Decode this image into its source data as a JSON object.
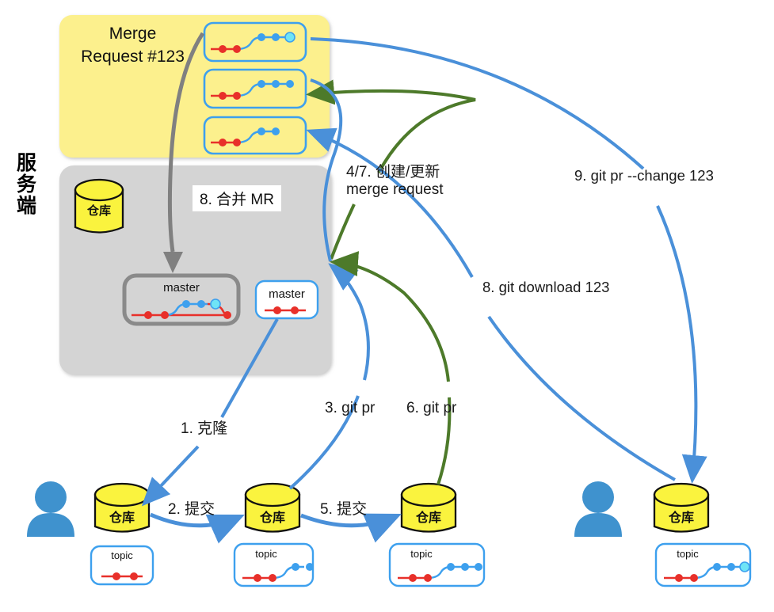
{
  "diagram": {
    "title_vertical": "服务端",
    "server_panel": {
      "mr_card_title": "Merge\nRequest #123",
      "merge_label": "8. 合并 MR",
      "repo_label": "仓库",
      "master_label": "master",
      "mr_items": [
        {
          "id": "mr-graph-1",
          "red_commits": 2,
          "blue_commits": 3,
          "head_highlight": true
        },
        {
          "id": "mr-graph-2",
          "red_commits": 2,
          "blue_commits": 3,
          "head_highlight": false
        },
        {
          "id": "mr-graph-3",
          "red_commits": 2,
          "blue_commits": 2,
          "head_highlight": false
        }
      ],
      "merged_master": {
        "label": "master",
        "red_commits": 3,
        "blue_commits": 3,
        "merged": true
      },
      "clone_master": {
        "label": "master",
        "red_commits": 2,
        "blue_commits": 0
      }
    },
    "clients": [
      {
        "id": "client-left",
        "person": "user-avatar",
        "repo_label": "仓库",
        "topic": {
          "label": "topic",
          "red_commits": 2,
          "blue_commits": 0,
          "head_highlight": false
        }
      },
      {
        "id": "client-mid",
        "repo_label": "仓库",
        "topic": {
          "label": "topic",
          "red_commits": 2,
          "blue_commits": 2,
          "head_highlight": false
        }
      },
      {
        "id": "client-mid2",
        "repo_label": "仓库",
        "topic": {
          "label": "topic",
          "red_commits": 2,
          "blue_commits": 3,
          "head_highlight": false
        }
      },
      {
        "id": "client-right",
        "person": "user-avatar",
        "repo_label": "仓库",
        "topic": {
          "label": "topic",
          "red_commits": 2,
          "blue_commits": 3,
          "head_highlight": true
        }
      }
    ],
    "edges": [
      {
        "id": "edge-clone",
        "label": "1. 克隆",
        "color": "#4a90d9"
      },
      {
        "id": "edge-commit-1",
        "label": "2. 提交",
        "color": "#4a90d9"
      },
      {
        "id": "edge-gitpr-3",
        "label": "3. git pr",
        "color": "#4a90d9"
      },
      {
        "id": "edge-create-mr",
        "label": "4/7. 创建/更新\nmerge request",
        "color": "#4d7a2a"
      },
      {
        "id": "edge-commit-5",
        "label": "5. 提交",
        "color": "#4a90d9"
      },
      {
        "id": "edge-gitpr-6",
        "label": "6. git pr",
        "color": "#4d7a2a"
      },
      {
        "id": "edge-merge-mr",
        "label": "8. 合并 MR",
        "color": "#808080"
      },
      {
        "id": "edge-download",
        "label": "8. git download 123",
        "color": "#4a90d9"
      },
      {
        "id": "edge-change",
        "label": "9. git pr --change 123",
        "color": "#4a90d9"
      }
    ],
    "labels": {
      "l1": "1. 克隆",
      "l2": "2. 提交",
      "l3": "3. git pr",
      "l4": "4/7. 创建/更新",
      "l4b": "merge request",
      "l5": "5. 提交",
      "l6": "6. git pr",
      "l8a": "8. 合并 MR",
      "l8b": "8. git download 123",
      "l9": "9. git pr --change 123"
    },
    "colors": {
      "yellow_panel": "#FCF08D",
      "gray_panel": "#D4D4D4",
      "blue": "#4a90d9",
      "green": "#4d7a2a",
      "gray_arrow": "#808080",
      "red_commit": "#E8302A",
      "blue_commit": "#3DA0EE",
      "cyan_head": "#6FE4F6",
      "repo_yellow": "#FAF33E",
      "person_blue": "#3F92CE"
    }
  }
}
